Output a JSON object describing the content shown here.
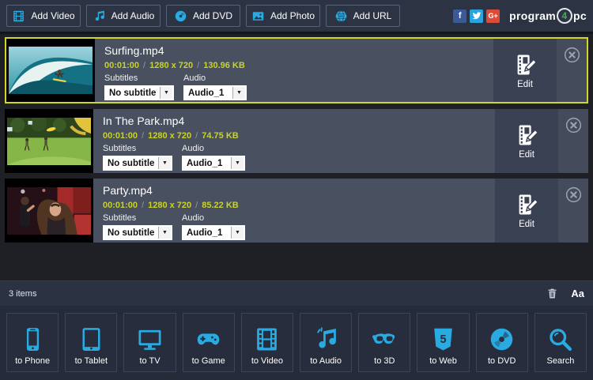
{
  "sep": "/",
  "colors": {
    "accent": "#29abe2",
    "meta_text": "#c9d32b",
    "selection_border": "#d2d52a",
    "facebook": "#3b5998",
    "twitter": "#2ba3dc",
    "google_plus": "#dc4a38",
    "logo_green": "#3cb54a"
  },
  "toolbar": {
    "buttons": [
      {
        "label": "Add Video",
        "icon": "film-icon"
      },
      {
        "label": "Add Audio",
        "icon": "music-note-icon"
      },
      {
        "label": "Add DVD",
        "icon": "disc-icon"
      },
      {
        "label": "Add Photo",
        "icon": "photo-icon"
      },
      {
        "label": "Add URL",
        "icon": "globe-icon",
        "glyph": "www"
      }
    ]
  },
  "social": [
    {
      "name": "facebook",
      "glyph": "f"
    },
    {
      "name": "twitter"
    },
    {
      "name": "google-plus",
      "glyph": "G+"
    }
  ],
  "logo": {
    "p1": "program",
    "n": "4",
    "p2": "pc"
  },
  "items": [
    {
      "title": "Surfing.mp4",
      "duration": "00:01:00",
      "resolution": "1280 x 720",
      "size": "130.96 KB",
      "subtitles_label": "Subtitles",
      "subtitles_value": "No subtitle",
      "audio_label": "Audio",
      "audio_value": "Audio_1",
      "edit_label": "Edit",
      "selected": true
    },
    {
      "title": "In The Park.mp4",
      "duration": "00:01:00",
      "resolution": "1280 x 720",
      "size": "74.75 KB",
      "subtitles_label": "Subtitles",
      "subtitles_value": "No subtitle",
      "audio_label": "Audio",
      "audio_value": "Audio_1",
      "edit_label": "Edit",
      "selected": false
    },
    {
      "title": "Party.mp4",
      "duration": "00:01:00",
      "resolution": "1280 x 720",
      "size": "85.22 KB",
      "subtitles_label": "Subtitles",
      "subtitles_value": "No subtitle",
      "audio_label": "Audio",
      "audio_value": "Audio_1",
      "edit_label": "Edit",
      "selected": false
    }
  ],
  "status": {
    "count": "3 items",
    "font_button": "Aa"
  },
  "dock": [
    {
      "label": "to Phone",
      "icon": "phone-icon"
    },
    {
      "label": "to Tablet",
      "icon": "tablet-icon"
    },
    {
      "label": "to TV",
      "icon": "tv-icon"
    },
    {
      "label": "to Game",
      "icon": "gamepad-icon"
    },
    {
      "label": "to Video",
      "icon": "film-icon"
    },
    {
      "label": "to Audio",
      "icon": "music-note-icon"
    },
    {
      "label": "to 3D",
      "icon": "3d-glasses-icon"
    },
    {
      "label": "to Web",
      "icon": "html5-shield-icon",
      "glyph": "5"
    },
    {
      "label": "to DVD",
      "icon": "disc-icon"
    },
    {
      "label": "Search",
      "icon": "search-icon"
    }
  ]
}
